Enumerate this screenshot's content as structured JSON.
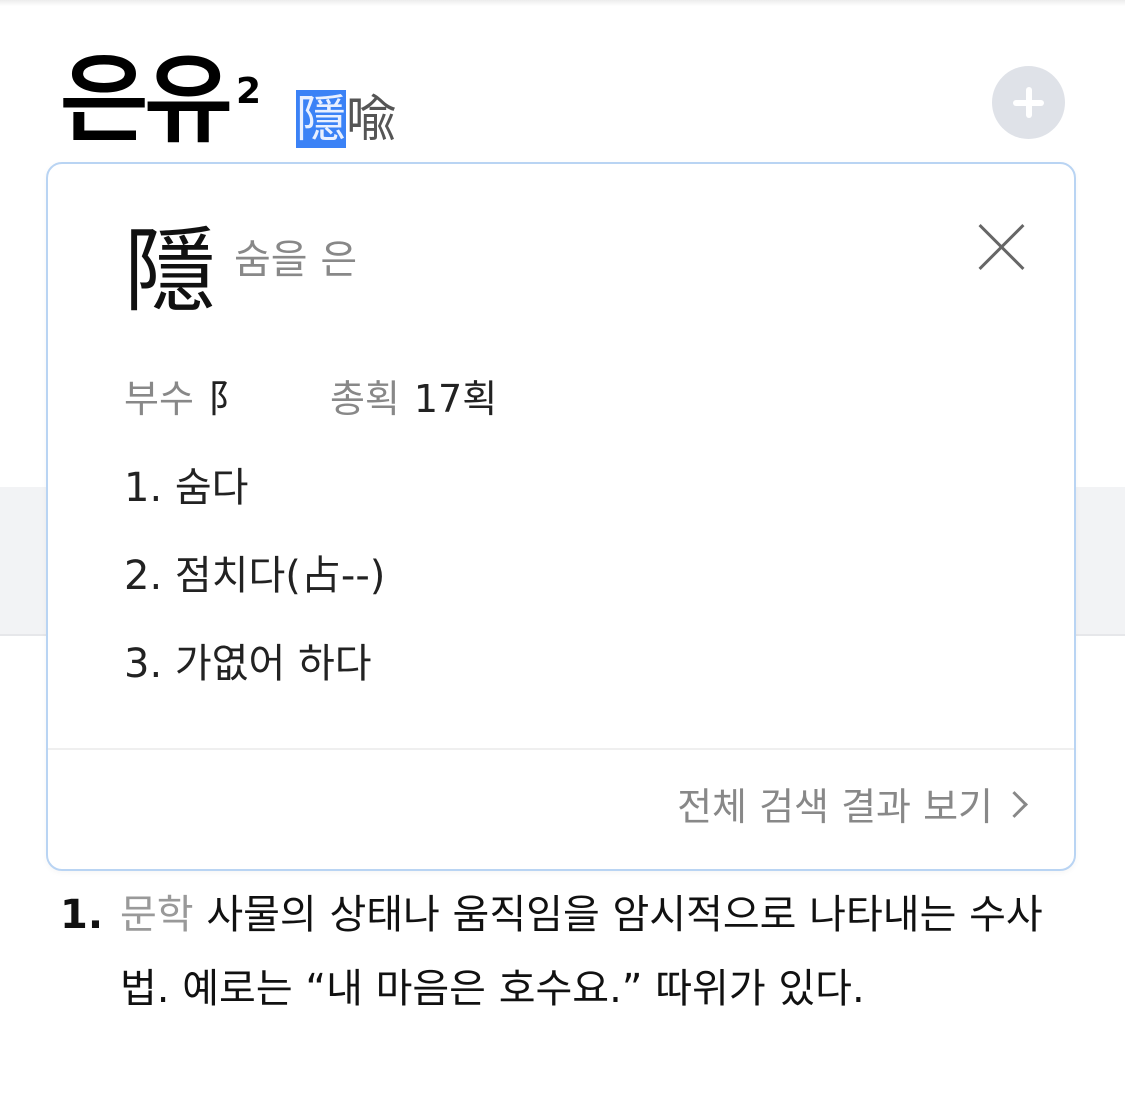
{
  "entry": {
    "headword": "은유",
    "superscript": "2",
    "hanja_chars": [
      "隱",
      "喩"
    ]
  },
  "popup": {
    "character": "隱",
    "meaning": "숨을 은",
    "radical_label": "부수",
    "radical_value": "阝",
    "strokes_label": "총획",
    "strokes_value": "17획",
    "meanings": [
      "1. 숨다",
      "2. 점치다(占--)",
      "3. 가엾어 하다"
    ],
    "see_all_label": "전체 검색 결과 보기"
  },
  "definition": {
    "number": "1.",
    "category": "문학",
    "text": "사물의 상태나 움직임을 암시적으로 나타내는 수사법. 예로는 “내 마음은 호수요.” 따위가 있다."
  },
  "colors": {
    "selection": "#3b82f6",
    "popup_border": "#b9d4f3",
    "muted_text": "#888888"
  }
}
